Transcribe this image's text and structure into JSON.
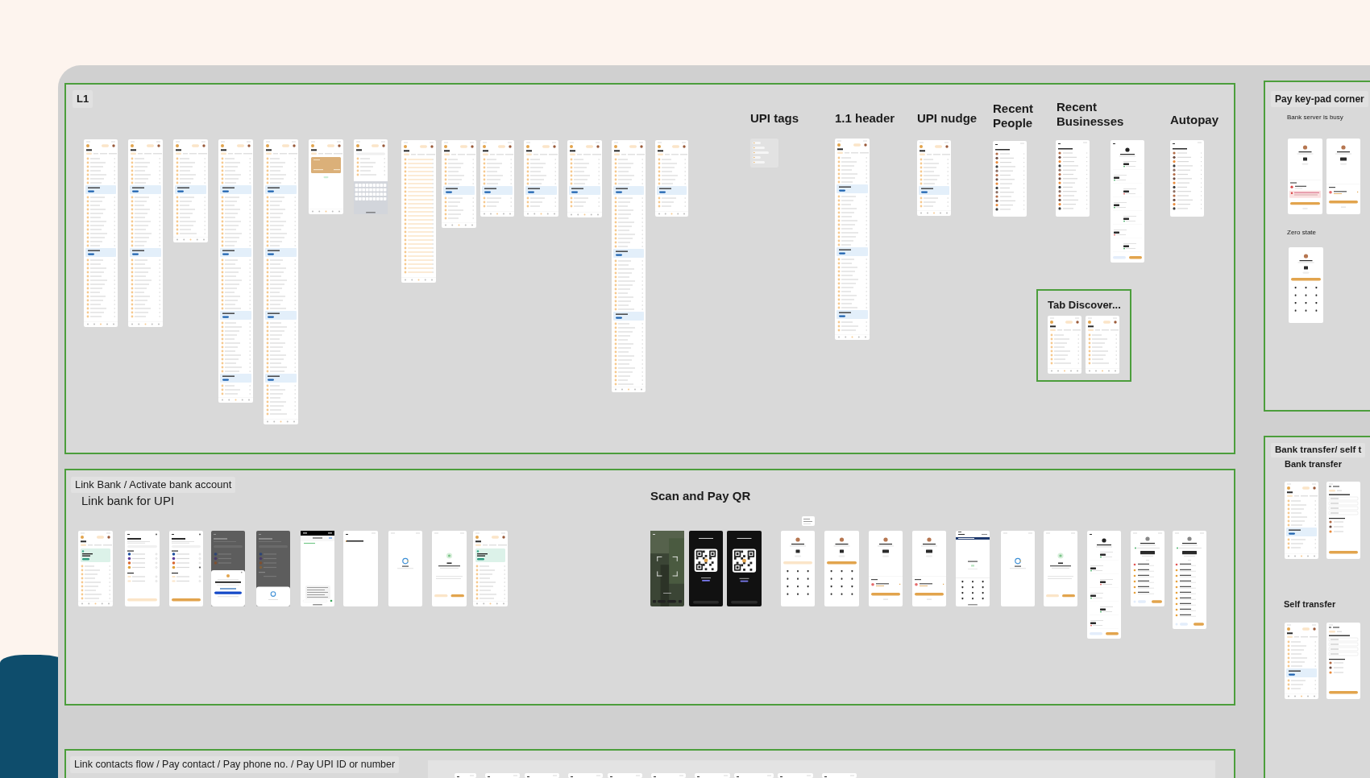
{
  "canvas": {
    "sections": [
      {
        "title": "L1",
        "labels": [
          "UPI tags",
          "1.1 header",
          "UPI nudge",
          "Recent People",
          "Recent Businesses",
          "Autopay"
        ],
        "frames": [
          {
            "kind": "list"
          },
          {
            "kind": "list"
          },
          {
            "kind": "list"
          },
          {
            "kind": "list"
          },
          {
            "kind": "list"
          },
          {
            "kind": "card"
          },
          {
            "kind": "keyboard"
          },
          {
            "kind": "skeleton"
          },
          {
            "kind": "list"
          },
          {
            "kind": "list"
          },
          {
            "kind": "list"
          },
          {
            "kind": "list"
          },
          {
            "kind": "list"
          },
          {
            "kind": "list"
          },
          {
            "kind": "tags"
          },
          {
            "kind": "list"
          },
          {
            "kind": "list"
          },
          {
            "kind": "contacts"
          },
          {
            "kind": "contacts"
          },
          {
            "kind": "details"
          },
          {
            "kind": "contacts"
          }
        ],
        "subsections": [
          {
            "title": "Tab Discover...",
            "frames": [
              {
                "kind": "list"
              },
              {
                "kind": "list"
              }
            ]
          }
        ]
      },
      {
        "title": "Link Bank / Activate bank account",
        "labels": [
          "Link bank for UPI",
          "Scan and Pay QR"
        ],
        "frames": [
          {
            "kind": "promo"
          },
          {
            "kind": "bank-list"
          },
          {
            "kind": "bank-selected"
          },
          {
            "kind": "sheet"
          },
          {
            "kind": "sheet-loader"
          },
          {
            "kind": "sms"
          },
          {
            "kind": "blank"
          },
          {
            "kind": "loader"
          },
          {
            "kind": "success"
          },
          {
            "kind": "promo"
          },
          {
            "kind": "camera"
          },
          {
            "kind": "qr"
          },
          {
            "kind": "qr"
          },
          {
            "kind": "note"
          },
          {
            "kind": "keypad-empty"
          },
          {
            "kind": "keypad"
          },
          {
            "kind": "checkout"
          },
          {
            "kind": "checkout"
          },
          {
            "kind": "pin"
          },
          {
            "kind": "loader"
          },
          {
            "kind": "success"
          },
          {
            "kind": "details"
          },
          {
            "kind": "receipt"
          },
          {
            "kind": "receipt"
          }
        ]
      },
      {
        "title": "Link contacts flow / Pay contact / Pay phone no. / Pay UPI ID or number",
        "frames": [
          {
            "kind": "blank"
          },
          {
            "kind": "blank"
          },
          {
            "kind": "blank"
          },
          {
            "kind": "blank"
          },
          {
            "kind": "blank"
          },
          {
            "kind": "blank"
          },
          {
            "kind": "blank"
          },
          {
            "kind": "blank"
          },
          {
            "kind": "blank"
          },
          {
            "kind": "blank"
          }
        ]
      },
      {
        "title": "Pay key-pad corner",
        "labels": [
          "Bank server is busy",
          "Zero state"
        ],
        "frames": [
          {
            "kind": "error"
          },
          {
            "kind": "checkout"
          },
          {
            "kind": "keypad"
          }
        ]
      },
      {
        "title": "Bank transfer/ self t",
        "labels": [
          "Bank transfer",
          "Self transfer"
        ],
        "frames": [
          {
            "kind": "list"
          },
          {
            "kind": "form"
          },
          {
            "kind": "list"
          },
          {
            "kind": "form"
          }
        ]
      }
    ]
  }
}
